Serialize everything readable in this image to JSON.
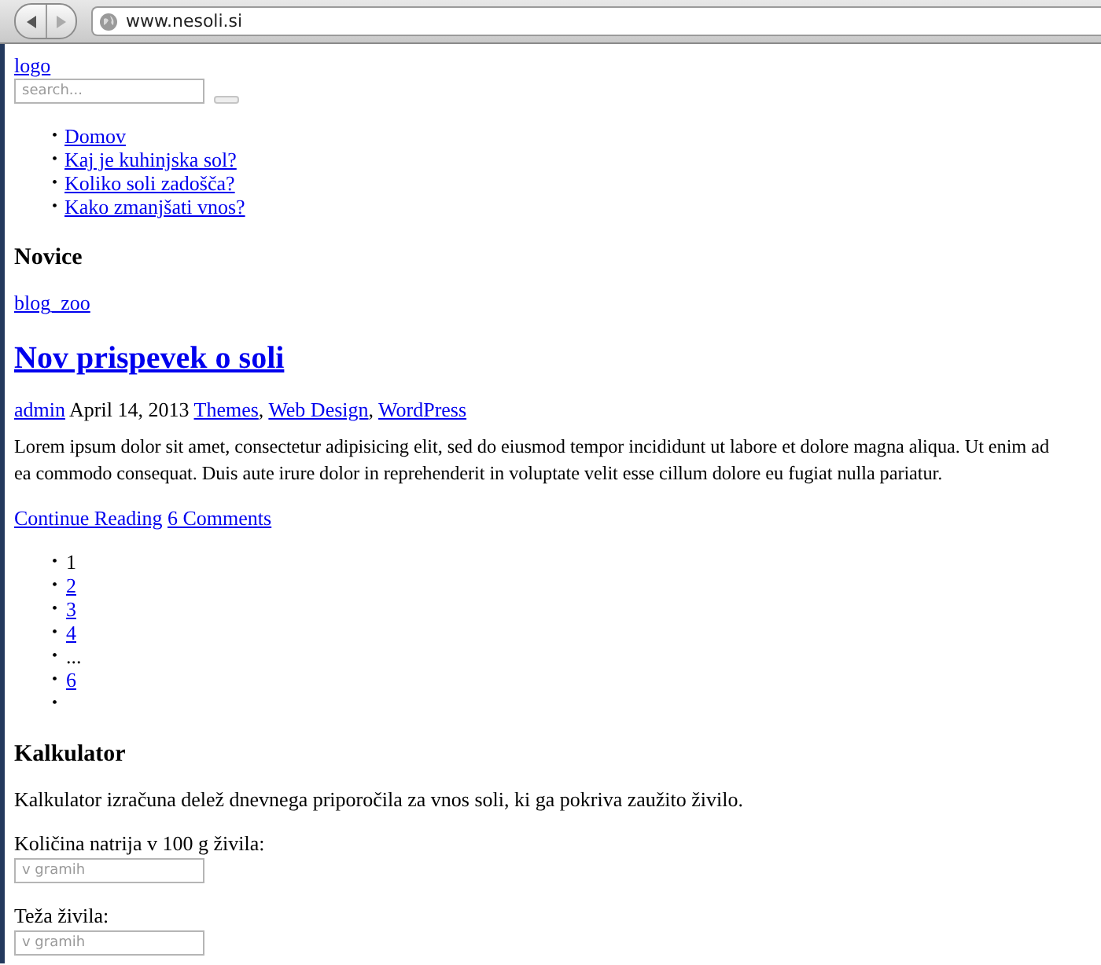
{
  "browser": {
    "url": "www.nesoli.si"
  },
  "header": {
    "logo": "logo",
    "search": {
      "placeholder": "search..."
    }
  },
  "nav": [
    {
      "bullet": "•",
      "label": "Domov"
    },
    {
      "bullet": "•",
      "label": "Kaj je kuhinjska sol?"
    },
    {
      "bullet": "•",
      "label": "Koliko soli zadošča?"
    },
    {
      "bullet": "•",
      "label": "Kako zmanjšati vnos?"
    }
  ],
  "news": {
    "heading": "Novice",
    "blog_link": "blog_zoo",
    "post": {
      "title": "Nov prispevek o soli",
      "author": "admin",
      "date": "April 14, 2013",
      "categories": [
        {
          "label": "Themes",
          "separator": ","
        },
        {
          "label": "Web Design",
          "separator": ","
        },
        {
          "label": "WordPress"
        }
      ],
      "body_lines": [
        "Lorem ipsum dolor sit amet, consectetur adipisicing elit, sed do eiusmod tempor incididunt ut labore et dolore magna aliqua. Ut enim ad",
        "ea commodo consequat. Duis aute irure dolor in reprehenderit in voluptate velit esse cillum dolore eu fugiat nulla pariatur."
      ],
      "continue_link": "Continue Reading",
      "comments_link": "6 Comments"
    }
  },
  "pagination": [
    {
      "kind": "current",
      "bullet": "•",
      "label": "1"
    },
    {
      "kind": "link",
      "bullet": "•",
      "label": "2"
    },
    {
      "kind": "link",
      "bullet": "•",
      "label": "3"
    },
    {
      "kind": "link",
      "bullet": "•",
      "label": "4"
    },
    {
      "kind": "gap",
      "bullet": "•",
      "label": "..."
    },
    {
      "kind": "link",
      "bullet": "•",
      "label": "6"
    },
    {
      "kind": "empty",
      "bullet": "•"
    }
  ],
  "calculator": {
    "heading": "Kalkulator",
    "description": "Kalkulator izračuna delež dnevnega priporočila za vnos soli, ki ga pokriva zaužito živilo.",
    "fields": [
      {
        "label": "Količina natrija v 100 g živila:",
        "placeholder": "v gramih"
      },
      {
        "label": "Teža živila:",
        "placeholder": "v gramih"
      }
    ]
  }
}
